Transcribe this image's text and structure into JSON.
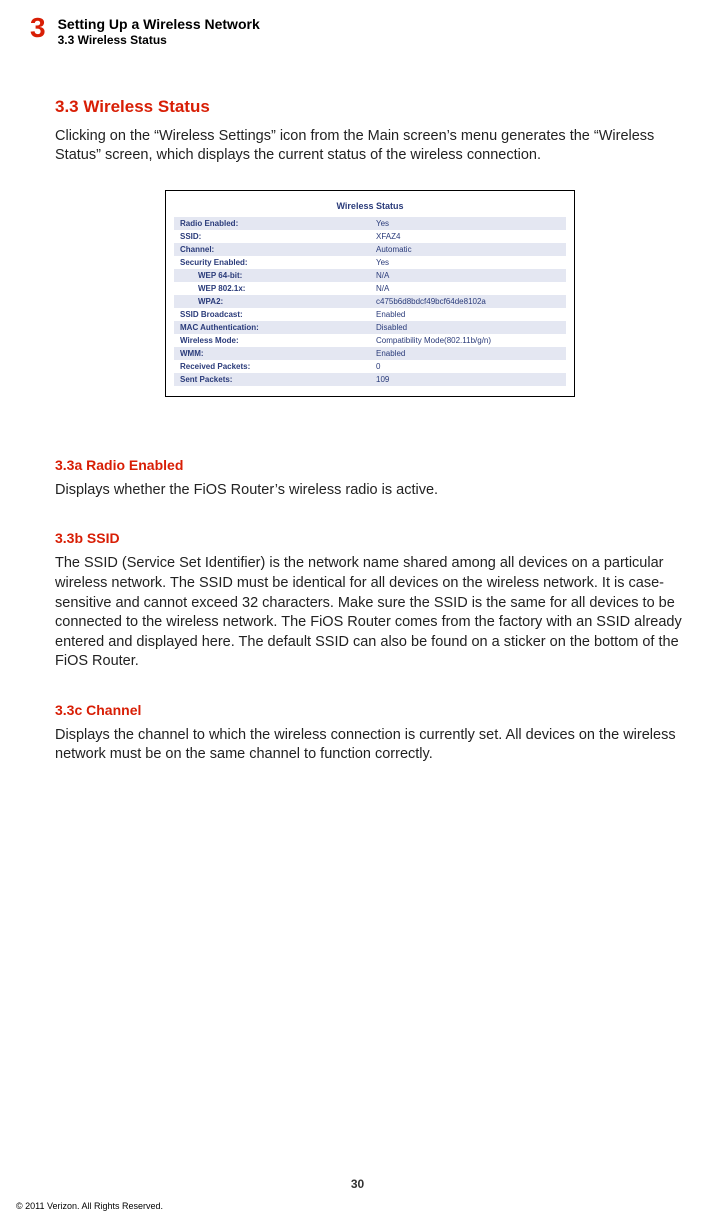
{
  "header": {
    "chapter_num": "3",
    "chapter_title": "Setting Up a Wireless Network",
    "section_label": "3.3  Wireless Status"
  },
  "main": {
    "heading": "3.3  Wireless Status",
    "intro": "Clicking on the “Wireless Settings” icon from the Main screen’s menu generates the “Wireless Status” screen, which displays the current status of the wireless connection."
  },
  "figure": {
    "title": "Wireless Status",
    "rows": [
      {
        "label": "Radio Enabled:",
        "value": "Yes",
        "band": true
      },
      {
        "label": "SSID:",
        "value": "XFAZ4",
        "band": false
      },
      {
        "label": "Channel:",
        "value": "Automatic",
        "band": true
      },
      {
        "label": "Security Enabled:",
        "value": "Yes",
        "band": false
      },
      {
        "label": "WEP 64-bit:",
        "value": "N/A",
        "band": true,
        "indent": true
      },
      {
        "label": "WEP 802.1x:",
        "value": "N/A",
        "band": false,
        "indent": true
      },
      {
        "label": "WPA2:",
        "value": "c475b6d8bdcf49bcf64de8102a",
        "band": true,
        "indent": true
      },
      {
        "label": "SSID Broadcast:",
        "value": "Enabled",
        "band": false
      },
      {
        "label": "MAC Authentication:",
        "value": "Disabled",
        "band": true
      },
      {
        "label": "Wireless Mode:",
        "value": "Compatibility Mode(802.11b/g/n)",
        "band": false
      },
      {
        "label": "WMM:",
        "value": "Enabled",
        "band": true
      },
      {
        "label": "Received Packets:",
        "value": "0",
        "band": false
      },
      {
        "label": "Sent Packets:",
        "value": "109",
        "band": true
      }
    ]
  },
  "subsections": [
    {
      "heading": "3.3a  Radio Enabled",
      "text": "Displays whether the FiOS Router’s wireless radio is active."
    },
    {
      "heading": "3.3b  SSID",
      "text": "The SSID (Service Set Identifier) is the network name shared among all devices on a particular wireless network. The SSID must be identical for all devices on the wireless network. It is case-sensitive and cannot exceed 32 characters. Make sure the SSID is the same for all devices to be connected to the wireless network. The FiOS Router comes from the factory with an SSID already entered and displayed here. The default SSID can also be found on a sticker on the bottom of the FiOS Router."
    },
    {
      "heading": "3.3c  Channel",
      "text": "Displays the channel to which the wireless connection is currently set. All devices on the wireless network must be on the same channel to function correctly."
    }
  ],
  "footer": {
    "page_num": "30",
    "copyright": "© 2011 Verizon. All Rights Reserved."
  }
}
